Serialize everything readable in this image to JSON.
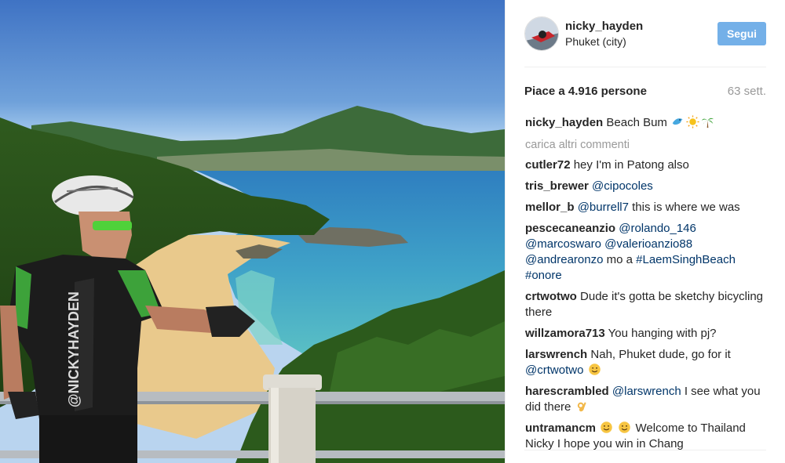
{
  "post": {
    "username": "nicky_hayden",
    "location": "Phuket (city)",
    "follow_label": "Segui",
    "likes_text": "Piace a 4.916 persone",
    "time_ago": "63 sett."
  },
  "caption": {
    "username": "nicky_hayden",
    "text": "Beach Bum",
    "emojis": [
      "dolphin-emoji",
      "sun-emoji",
      "palm-tree-emoji"
    ]
  },
  "load_more_label": "carica altri commenti",
  "comments": [
    {
      "user": "cutler72",
      "parts": [
        {
          "t": "text",
          "v": "hey I'm in Patong also"
        }
      ]
    },
    {
      "user": "tris_brewer",
      "parts": [
        {
          "t": "mention",
          "v": "@cipocoles"
        }
      ]
    },
    {
      "user": "mellor_b",
      "parts": [
        {
          "t": "mention",
          "v": "@burrell7"
        },
        {
          "t": "text",
          "v": " this is where we was"
        }
      ]
    },
    {
      "user": "pescecaneanzio",
      "parts": [
        {
          "t": "mention",
          "v": "@rolando_146"
        },
        {
          "t": "text",
          "v": " "
        },
        {
          "t": "mention",
          "v": "@marcoswaro"
        },
        {
          "t": "text",
          "v": " "
        },
        {
          "t": "mention",
          "v": "@valerioanzio88"
        },
        {
          "t": "text",
          "v": " "
        },
        {
          "t": "mention",
          "v": "@andrearonzo"
        },
        {
          "t": "text",
          "v": " mo a "
        },
        {
          "t": "mention",
          "v": "#LaemSinghBeach"
        },
        {
          "t": "text",
          "v": " "
        },
        {
          "t": "mention",
          "v": "#onore"
        }
      ]
    },
    {
      "user": "crtwotwo",
      "parts": [
        {
          "t": "text",
          "v": "Dude it's gotta be sketchy bicycling there"
        }
      ]
    },
    {
      "user": "willzamora713",
      "parts": [
        {
          "t": "text",
          "v": "You hanging with pj?"
        }
      ]
    },
    {
      "user": "larswrench",
      "parts": [
        {
          "t": "text",
          "v": "Nah, Phuket dude, go for it "
        },
        {
          "t": "mention",
          "v": "@crtwotwo"
        },
        {
          "t": "text",
          "v": " "
        },
        {
          "t": "emoji",
          "v": "wink-emoji"
        }
      ]
    },
    {
      "user": "harescrambled",
      "parts": [
        {
          "t": "mention",
          "v": "@larswrench"
        },
        {
          "t": "text",
          "v": " I see what you did there "
        },
        {
          "t": "emoji",
          "v": "ok-hand-emoji"
        }
      ]
    },
    {
      "user": "untramancm",
      "parts": [
        {
          "t": "emoji",
          "v": "smile-emoji"
        },
        {
          "t": "text",
          "v": " "
        },
        {
          "t": "emoji",
          "v": "smile-emoji"
        },
        {
          "t": "text",
          "v": " Welcome to Thailand Nicky I hope you win in Chang"
        }
      ]
    }
  ],
  "photo": {
    "jersey_text": "@NICKYHAYDEN"
  },
  "colors": {
    "follow_button": "#74b0e8",
    "mention": "#003569",
    "muted": "#999999"
  }
}
